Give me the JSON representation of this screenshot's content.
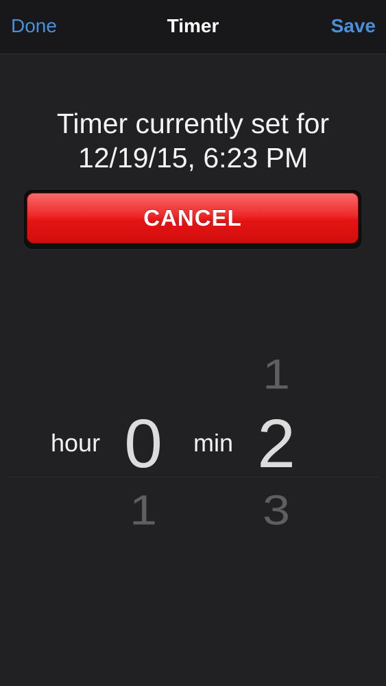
{
  "navbar": {
    "left_label": "Done",
    "title": "Timer",
    "right_label": "Save"
  },
  "status": {
    "line1": "Timer currently set for",
    "line2": "12/19/15, 6:23 PM"
  },
  "cancel_button": {
    "label": "CANCEL"
  },
  "picker": {
    "hour": {
      "label": "hour",
      "selected": "0",
      "below": "1"
    },
    "minute": {
      "label": "min",
      "above": "1",
      "selected": "2",
      "below": "3"
    }
  },
  "colors": {
    "background": "#212124",
    "navbar": "#18181a",
    "accent": "#4a90d9",
    "cancel_red": "#e51414"
  }
}
